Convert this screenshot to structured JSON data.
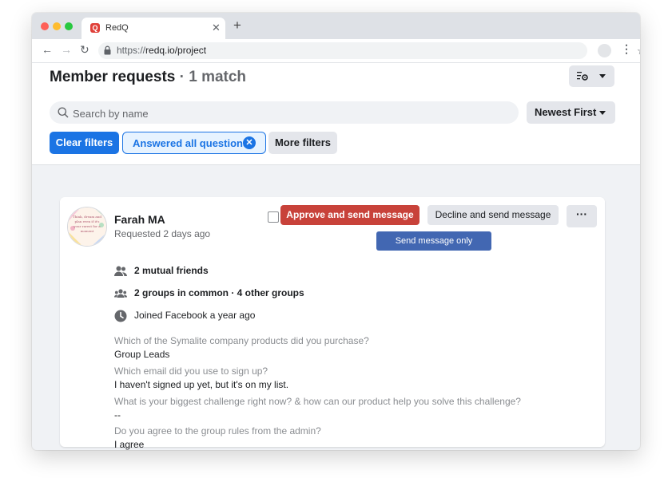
{
  "browser": {
    "tab_title": "RedQ",
    "favicon_letter": "Q",
    "url_prefix": "https://",
    "url_main": "redq.io/project"
  },
  "header": {
    "title": "Member requests",
    "match_text": " · 1 match",
    "search_placeholder": "Search by name",
    "sort_label": "Newest First",
    "clear_filters_label": "Clear filters",
    "active_filter_label": "Answered all questions",
    "more_filters_label": "More filters"
  },
  "request": {
    "name": "Farah MA",
    "requested": "Requested 2 days ago",
    "approve_label": "Approve and send message",
    "decline_label": "Decline and send message",
    "send_only_label": "Send message only",
    "more_label": "···",
    "avatar_text": "Think, dream and plan even if it's your rarest for a moment",
    "mutual_friends": "2 mutual friends",
    "groups_in_common": "2 groups in common · 4 other groups",
    "joined": "Joined Facebook a year ago",
    "questions": [
      {
        "q": "Which of the Symalite company products did you purchase?",
        "a": "Group Leads"
      },
      {
        "q": "Which email did you use to sign up?",
        "a": "I haven't signed up yet, but it's on my list."
      },
      {
        "q": "What is your biggest challenge right now? & how can our product help you solve this challenge?",
        "a": "--"
      },
      {
        "q": "Do you agree to the group rules from the admin?",
        "a": "I agree"
      }
    ]
  },
  "colors": {
    "primary": "#1b74e4",
    "approve": "#c8423a",
    "send_message": "#4267b2",
    "page_background": "#f0f2f5"
  },
  "icons": [
    "lock-icon",
    "star-icon",
    "gear-icon",
    "search-icon",
    "friends-icon",
    "groups-icon",
    "clock-icon",
    "close-icon"
  ]
}
